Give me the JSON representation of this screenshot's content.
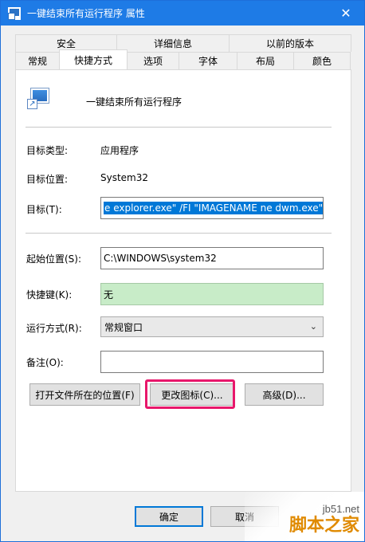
{
  "window": {
    "title": "一键结束所有运行程序 属性",
    "close_glyph": "✕"
  },
  "tabs": {
    "back_row": [
      "安全",
      "详细信息",
      "以前的版本"
    ],
    "front_row": [
      "常规",
      "快捷方式",
      "选项",
      "字体",
      "布局",
      "颜色"
    ],
    "active": "快捷方式"
  },
  "shortcut": {
    "app_name": "一键结束所有运行程序",
    "target_type_label": "目标类型:",
    "target_type_value": "应用程序",
    "target_location_label": "目标位置:",
    "target_location_value": "System32",
    "target_label": "目标(T):",
    "target_value": "e explorer.exe\" /FI \"IMAGENAME ne dwm.exe\"",
    "start_in_label": "起始位置(S):",
    "start_in_value": "C:\\WINDOWS\\system32",
    "hotkey_label": "快捷键(K):",
    "hotkey_value": "无",
    "run_label": "运行方式(R):",
    "run_value": "常规窗口",
    "comment_label": "备注(O):",
    "comment_value": ""
  },
  "buttons": {
    "open_location": "打开文件所在的位置(F)",
    "change_icon": "更改图标(C)...",
    "advanced": "高级(D)...",
    "ok": "确定",
    "cancel": "取消"
  },
  "watermark": {
    "site": "jb51.net",
    "text": "脚本之家"
  },
  "colors": {
    "titlebar": "#1e7be6",
    "selection": "#0078d7",
    "hotkey_bg": "#c8ecc8",
    "highlight": "#e8176b"
  }
}
